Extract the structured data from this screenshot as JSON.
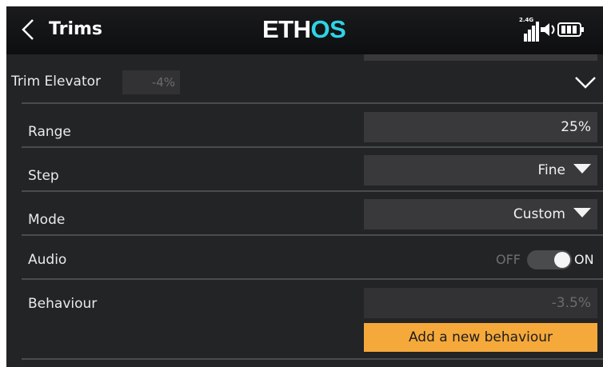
{
  "header": {
    "title": "Trims",
    "logo": {
      "main": "ETH",
      "accent": "OS"
    },
    "band_label": "2.4G",
    "icons": [
      "back-chevron-icon",
      "signal-bars-icon",
      "speaker-icon",
      "battery-icon"
    ]
  },
  "trim_section": {
    "label": "Trim Elevator",
    "value": "-4%",
    "expanded": true
  },
  "rows": {
    "range": {
      "label": "Range",
      "value": "25%"
    },
    "step": {
      "label": "Step",
      "value": "Fine"
    },
    "mode": {
      "label": "Mode",
      "value": "Custom"
    },
    "audio": {
      "label": "Audio",
      "off_label": "OFF",
      "on_label": "ON",
      "enabled": true
    },
    "behaviour": {
      "label": "Behaviour",
      "value": "-3.5%",
      "add_button": "Add a new behaviour"
    }
  },
  "colors": {
    "background": "#222425",
    "field": "#39393b",
    "accent_button": "#f6a93b",
    "logo_accent": "#2fd3e6"
  }
}
